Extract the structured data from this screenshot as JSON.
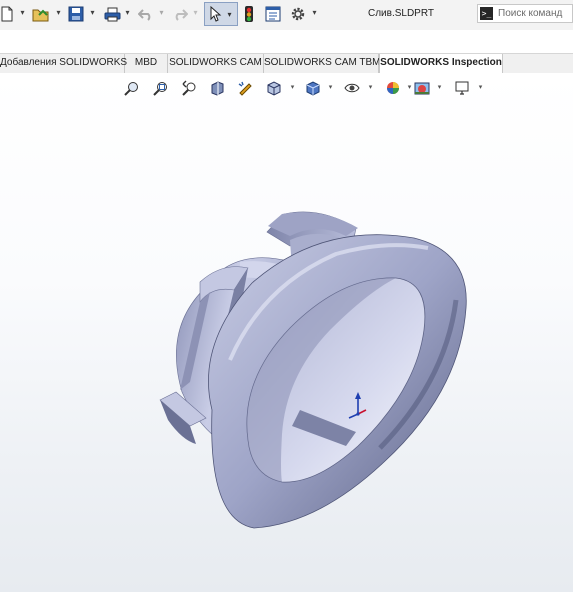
{
  "toolbar": {
    "items": [
      "new-document-icon",
      "open-folder-icon",
      "save-icon",
      "print-icon",
      "undo-icon",
      "redo-icon",
      "select-pointer-icon",
      "rebuild-traffic-light-icon",
      "file-properties-icon",
      "options-gear-icon"
    ]
  },
  "document": {
    "title": "Слив.SLDPRT"
  },
  "search": {
    "placeholder": "Поиск команд"
  },
  "tabs": [
    {
      "label": "Добавления SOLIDWORKS"
    },
    {
      "label": "MBD"
    },
    {
      "label": "SOLIDWORKS CAM"
    },
    {
      "label": "SOLIDWORKS CAM TBM"
    },
    {
      "label": "SOLIDWORKS Inspection",
      "active": true
    }
  ],
  "heads_up_toolbar": {
    "items": [
      "zoom-to-fit-icon",
      "zoom-to-area-icon",
      "previous-view-icon",
      "section-view-icon",
      "dynamic-annotation-views-icon",
      "view-orientation-icon",
      "display-style-icon",
      "hide-show-items-icon",
      "edit-appearance-icon",
      "apply-scene-icon",
      "view-settings-icon"
    ]
  },
  "colors": {
    "part": "#b3b8d6",
    "part_shade": "#6f7598",
    "triad_x": "#c8102e",
    "triad_y": "#1f3fb0"
  }
}
